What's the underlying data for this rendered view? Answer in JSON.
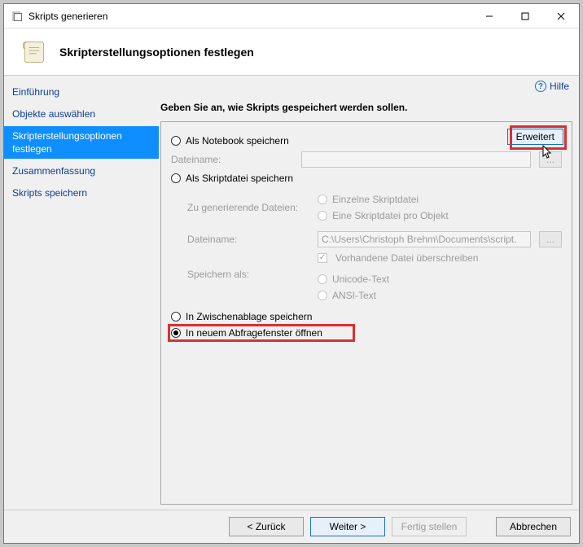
{
  "window": {
    "title": "Skripts generieren"
  },
  "header": {
    "title": "Skripterstellungsoptionen festlegen"
  },
  "help": {
    "label": "Hilfe"
  },
  "sidebar": {
    "items": [
      {
        "label": "Einführung",
        "selected": false
      },
      {
        "label": "Objekte auswählen",
        "selected": false
      },
      {
        "label": "Skripterstellungsoptionen festlegen",
        "selected": true
      },
      {
        "label": "Zusammenfassung",
        "selected": false
      },
      {
        "label": "Skripts speichern",
        "selected": false
      }
    ]
  },
  "main": {
    "instruction": "Geben Sie an, wie Skripts gespeichert werden sollen.",
    "advanced_button": "Erweitert",
    "options": {
      "notebook": {
        "label": "Als Notebook speichern",
        "filename_label": "Dateiname:",
        "filename_value": ""
      },
      "scriptfile": {
        "label": "Als Skriptdatei speichern",
        "files_to_generate_label": "Zu generierende Dateien:",
        "single_label": "Einzelne Skriptdatei",
        "per_object_label": "Eine Skriptdatei pro Objekt",
        "filename_label": "Dateiname:",
        "filename_value": "C:\\Users\\Christoph Brehm\\Documents\\script.",
        "overwrite_label": "Vorhandene Datei überschreiben",
        "save_as_label": "Speichern als:",
        "unicode_label": "Unicode-Text",
        "ansi_label": "ANSI-Text"
      },
      "clipboard": {
        "label": "In Zwischenablage speichern"
      },
      "query_window": {
        "label": "In neuem Abfragefenster öffnen"
      }
    }
  },
  "footer": {
    "back": "< Zurück",
    "next": "Weiter >",
    "finish": "Fertig stellen",
    "cancel": "Abbrechen"
  }
}
